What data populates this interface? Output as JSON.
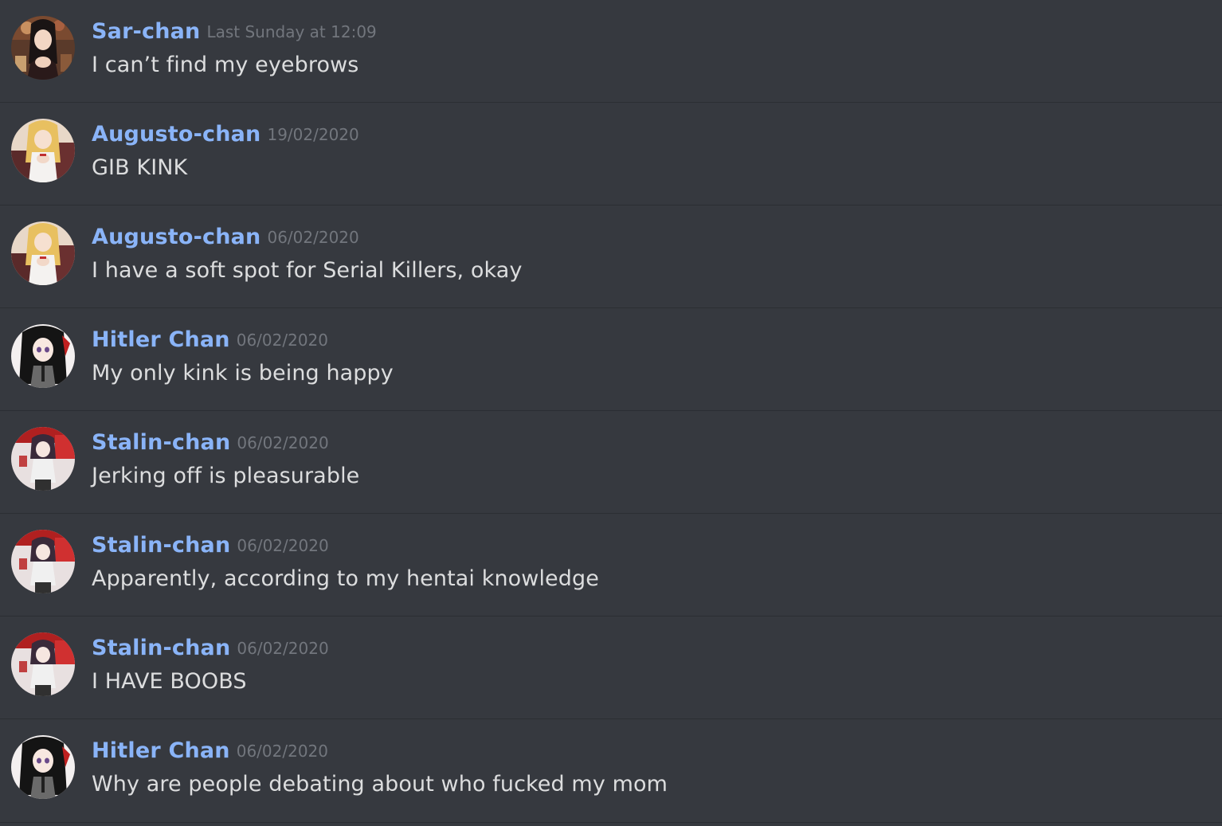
{
  "messages": [
    {
      "username": "Sar-chan",
      "timestamp": "Last Sunday at 12:09",
      "content": "I can’t find my eyebrows",
      "avatar": "sar-chan-avatar"
    },
    {
      "username": "Augusto-chan",
      "timestamp": "19/02/2020",
      "content": "GIB KINK",
      "avatar": "augusto-chan-avatar"
    },
    {
      "username": "Augusto-chan",
      "timestamp": "06/02/2020",
      "content": "I have a soft spot for Serial Killers, okay",
      "avatar": "augusto-chan-avatar"
    },
    {
      "username": "Hitler Chan",
      "timestamp": "06/02/2020",
      "content": "My only kink is being happy",
      "avatar": "hitler-chan-avatar"
    },
    {
      "username": "Stalin-chan",
      "timestamp": "06/02/2020",
      "content": "Jerking off is pleasurable",
      "avatar": "stalin-chan-avatar"
    },
    {
      "username": "Stalin-chan",
      "timestamp": "06/02/2020",
      "content": "Apparently, according to my hentai knowledge",
      "avatar": "stalin-chan-avatar"
    },
    {
      "username": "Stalin-chan",
      "timestamp": "06/02/2020",
      "content": "I HAVE BOOBS",
      "avatar": "stalin-chan-avatar"
    },
    {
      "username": "Hitler Chan",
      "timestamp": "06/02/2020",
      "content": "Why are people debating about who fucked my mom",
      "avatar": "hitler-chan-avatar"
    }
  ],
  "colors": {
    "background": "#36393f",
    "divider": "#2b2e33",
    "username": "#8ab4f8",
    "timestamp": "#72767d",
    "text": "#dcddde"
  }
}
